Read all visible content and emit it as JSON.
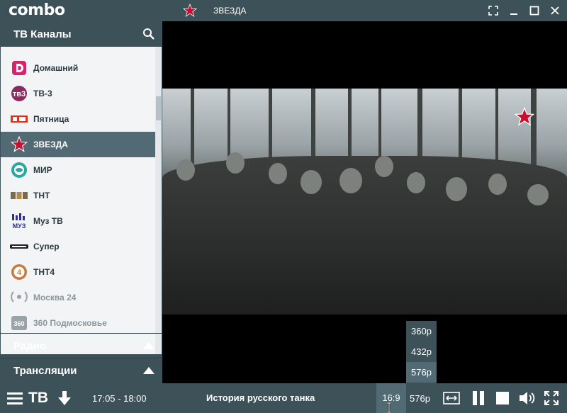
{
  "app": {
    "logo": "combo",
    "current_channel": "ЗВЕЗДА"
  },
  "window_controls": [
    "fullscreen-exit-icon",
    "minimize-icon",
    "maximize-icon",
    "close-icon"
  ],
  "sidebar": {
    "title": "ТВ Каналы",
    "channels": [
      {
        "label": "Домашний",
        "icon": "domashniy-logo-icon",
        "color": "#d8236b"
      },
      {
        "label": "ТВ-3",
        "icon": "tv3-logo-icon",
        "color": "#8a2a5e"
      },
      {
        "label": "Пятница",
        "icon": "pyatnica-logo-icon",
        "color": "#e0321b"
      },
      {
        "label": "ЗВЕЗДА",
        "icon": "zvezda-logo-icon",
        "color": "#c8102e",
        "selected": true
      },
      {
        "label": "МИР",
        "icon": "mir-logo-icon",
        "color": "#2aa8a0"
      },
      {
        "label": "ТНТ",
        "icon": "tnt-logo-icon",
        "color": "#7a6b4e"
      },
      {
        "label": "Муз ТВ",
        "icon": "muztv-logo-icon",
        "color": "#2e2f8e"
      },
      {
        "label": "Супер",
        "icon": "super-logo-icon",
        "color": "#222222"
      },
      {
        "label": "ТНТ4",
        "icon": "tnt4-logo-icon",
        "color": "#c77a3a"
      },
      {
        "label": "Москва 24",
        "icon": "moskva24-logo-icon",
        "color": "#9aa4a8",
        "dim": true
      },
      {
        "label": "360 Подмосковье",
        "icon": "360-logo-icon",
        "color": "#9aa4a8",
        "dim": true
      }
    ],
    "sections": [
      {
        "label": "Радио"
      },
      {
        "label": "Трансляции"
      }
    ]
  },
  "resolution_menu": {
    "options": [
      "360p",
      "432p",
      "576p"
    ],
    "selected": "576p"
  },
  "bottom_bar": {
    "tv_label": "ТВ",
    "time": "17:05 - 18:00",
    "program": "История русского танка",
    "aspect": "16:9",
    "resolution": "576p"
  },
  "colors": {
    "panel": "#3d5158",
    "selected": "#526a74",
    "list_bg": "#f2f4f5"
  }
}
